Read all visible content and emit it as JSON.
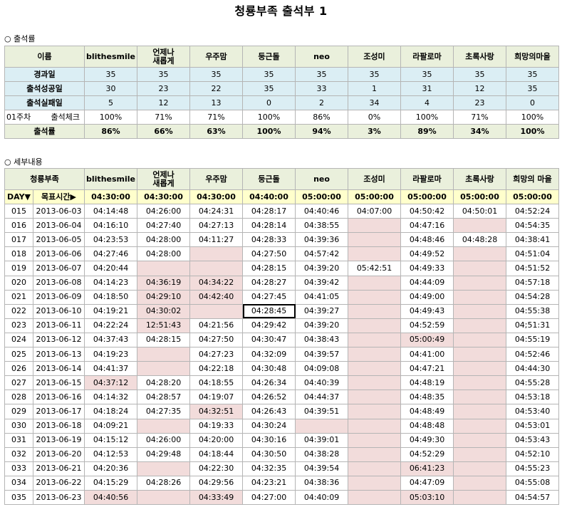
{
  "title": "청룡부족 출석부 1",
  "section1": "○ 출석률",
  "section2": "○ 세부내용",
  "members": [
    "blithesmile",
    "언제나\n새롭게",
    "우주맘",
    "둥근돌",
    "neo",
    "조성미",
    "라팔로마",
    "초록사랑",
    "희망의마을"
  ],
  "members2": [
    "blithesmile",
    "언제나\n새롭게",
    "우주맘",
    "둥근돌",
    "neo",
    "조성미",
    "라팔로마",
    "초록사랑",
    "희망의 마을"
  ],
  "summary": {
    "header": "이름",
    "rows": [
      {
        "label": "경과일",
        "values": [
          "35",
          "35",
          "35",
          "35",
          "35",
          "35",
          "35",
          "35",
          "35"
        ]
      },
      {
        "label": "출석성공일",
        "values": [
          "30",
          "23",
          "22",
          "35",
          "33",
          "1",
          "31",
          "12",
          "35"
        ]
      },
      {
        "label": "출석실패일",
        "values": [
          "5",
          "12",
          "13",
          "0",
          "2",
          "34",
          "4",
          "23",
          "0"
        ]
      }
    ],
    "check_row": {
      "week": "01주차",
      "label": "출석체크",
      "values": [
        "100%",
        "71%",
        "71%",
        "100%",
        "86%",
        "0%",
        "100%",
        "71%",
        "100%"
      ]
    },
    "rate_row": {
      "label": "출석률",
      "values": [
        "86%",
        "66%",
        "63%",
        "100%",
        "94%",
        "3%",
        "89%",
        "34%",
        "100%"
      ]
    }
  },
  "detail": {
    "header": "청룡부족",
    "day_label": "DAY▼",
    "target_label": "목표시간▶",
    "targets": [
      "04:30:00",
      "04:30:00",
      "04:30:00",
      "04:40:00",
      "05:00:00",
      "05:00:00",
      "05:00:00",
      "05:00:00",
      "05:00:00"
    ],
    "rows": [
      {
        "day": "015",
        "date": "2013-06-03",
        "cells": [
          "04:14:48",
          "04:26:00",
          "04:24:31",
          "04:28:17",
          "04:40:46",
          "04:07:00",
          "04:50:42",
          "04:50:01",
          "04:52:24"
        ]
      },
      {
        "day": "016",
        "date": "2013-06-04",
        "cells": [
          "04:16:10",
          "04:27:40",
          "04:27:13",
          "04:28:14",
          "04:38:55",
          "",
          "04:47:16",
          "",
          "04:54:35"
        ]
      },
      {
        "day": "017",
        "date": "2013-06-05",
        "cells": [
          "04:23:53",
          "04:28:00",
          "04:11:27",
          "04:28:33",
          "04:39:36",
          "",
          "04:48:46",
          "04:48:28",
          "04:38:41"
        ]
      },
      {
        "day": "018",
        "date": "2013-06-06",
        "cells": [
          "04:27:46",
          "04:28:00",
          "",
          "04:27:50",
          "04:57:42",
          "",
          "04:49:52",
          "",
          "04:51:04"
        ]
      },
      {
        "day": "019",
        "date": "2013-06-07",
        "cells": [
          "04:20:44",
          "",
          "",
          "04:28:15",
          "04:39:20",
          "05:42:51",
          "04:49:33",
          "",
          "04:51:52"
        ]
      },
      {
        "day": "020",
        "date": "2013-06-08",
        "cells": [
          "04:14:23",
          "04:36:19",
          "04:34:22",
          "04:28:27",
          "04:39:42",
          "",
          "04:44:09",
          "",
          "04:57:18"
        ]
      },
      {
        "day": "021",
        "date": "2013-06-09",
        "cells": [
          "04:18:50",
          "04:29:10",
          "04:42:40",
          "04:27:45",
          "04:41:05",
          "",
          "04:49:00",
          "",
          "04:54:28"
        ]
      },
      {
        "day": "022",
        "date": "2013-06-10",
        "cells": [
          "04:19:21",
          "04:30:02",
          "",
          "04:28:45",
          "04:39:27",
          "",
          "04:49:43",
          "",
          "04:55:38"
        ]
      },
      {
        "day": "023",
        "date": "2013-06-11",
        "cells": [
          "04:22:24",
          "12:51:43",
          "04:21:56",
          "04:29:42",
          "04:39:20",
          "",
          "04:52:59",
          "",
          "04;51:31"
        ]
      },
      {
        "day": "024",
        "date": "2013-06-12",
        "cells": [
          "04:37:43",
          "04:28:15",
          "04:27:50",
          "04:30:47",
          "04:38:43",
          "",
          "05:00:49",
          "",
          "04:55:19"
        ]
      },
      {
        "day": "025",
        "date": "2013-06-13",
        "cells": [
          "04:19:23",
          "",
          "04:27:23",
          "04:32:09",
          "04:39:57",
          "",
          "04:41:00",
          "",
          "04:52:46"
        ]
      },
      {
        "day": "026",
        "date": "2013-06-14",
        "cells": [
          "04:41:37",
          "",
          "04:22:18",
          "04:30:48",
          "04:09:08",
          "",
          "04:47:21",
          "",
          "04:44:30"
        ]
      },
      {
        "day": "027",
        "date": "2013-06-15",
        "cells": [
          "04:37:12",
          "04:28:20",
          "04:18:55",
          "04:26:34",
          "04:40:39",
          "",
          "04:48:19",
          "",
          "04:55:28"
        ]
      },
      {
        "day": "028",
        "date": "2013-06-16",
        "cells": [
          "04:14:32",
          "04:28:57",
          "04:19:07",
          "04:26:52",
          "04:44:37",
          "",
          "04:48:35",
          "",
          "04:53:18"
        ]
      },
      {
        "day": "029",
        "date": "2013-06-17",
        "cells": [
          "04:18:24",
          "04:27:35",
          "04:32:51",
          "04:26:43",
          "04:39:51",
          "",
          "04:48:49",
          "",
          "04:53:40"
        ]
      },
      {
        "day": "030",
        "date": "2013-06-18",
        "cells": [
          "04:09:21",
          "",
          "04:19:33",
          "04:30:24",
          "",
          "",
          "04:48:48",
          "",
          "04:53:01"
        ]
      },
      {
        "day": "031",
        "date": "2013-06-19",
        "cells": [
          "04:15:12",
          "04:26:00",
          "04:20:00",
          "04:30:16",
          "04:39:01",
          "",
          "04:49:30",
          "",
          "04:53:43"
        ]
      },
      {
        "day": "032",
        "date": "2013-06-20",
        "cells": [
          "04:12:53",
          "04:29:48",
          "04:18:44",
          "04:30:50",
          "04:38:28",
          "",
          "04:52:29",
          "",
          "04:52:10"
        ]
      },
      {
        "day": "033",
        "date": "2013-06-21",
        "cells": [
          "04:20:36",
          "",
          "04:22:30",
          "04:32:35",
          "04:39:54",
          "",
          "06:41:23",
          "",
          "04:55:23"
        ]
      },
      {
        "day": "034",
        "date": "2013-06-22",
        "cells": [
          "04:15:29",
          "04:28:26",
          "04:29:56",
          "04:23:21",
          "04:38:36",
          "",
          "04:47:09",
          "",
          "04:55:08"
        ]
      },
      {
        "day": "035",
        "date": "2013-06-23",
        "cells": [
          "04:40:56",
          "",
          "04:33:49",
          "04:27:00",
          "04:40:09",
          "",
          "05:03:10",
          "",
          "04:54:57"
        ]
      }
    ]
  },
  "colors": {
    "header_green": "#eaf0dc",
    "summary_blue": "#dbeef4",
    "target_yellow": "#ffffcc",
    "late_pink": "#f2dcdb",
    "grid": "#b5b5b5"
  }
}
